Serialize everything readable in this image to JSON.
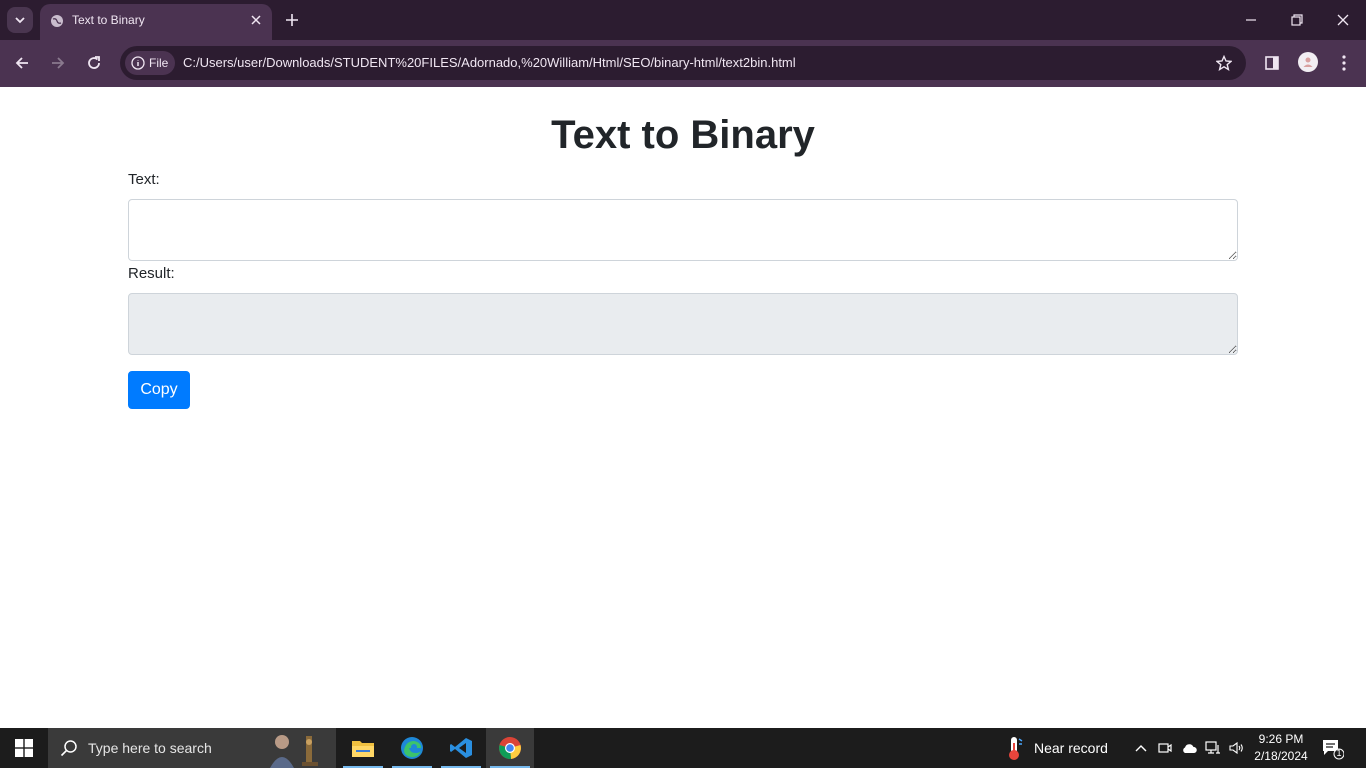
{
  "browser": {
    "tab_title": "Text to Binary",
    "url_chip": "File",
    "url": "C:/Users/user/Downloads/STUDENT%20FILES/Adornado,%20William/Html/SEO/binary-html/text2bin.html"
  },
  "page": {
    "title": "Text to Binary",
    "text_label": "Text:",
    "text_value": "",
    "result_label": "Result:",
    "result_value": "",
    "copy_label": "Copy"
  },
  "taskbar": {
    "search_placeholder": "Type here to search",
    "weather_text": "Near record",
    "time": "9:26 PM",
    "date": "2/18/2024",
    "notification_count": "1"
  },
  "colors": {
    "browser_frame": "#2c1c30",
    "browser_toolbar": "#4b3351",
    "button_primary": "#007bff",
    "readonly_bg": "#e9ecef",
    "taskbar": "#1c1c1c"
  }
}
